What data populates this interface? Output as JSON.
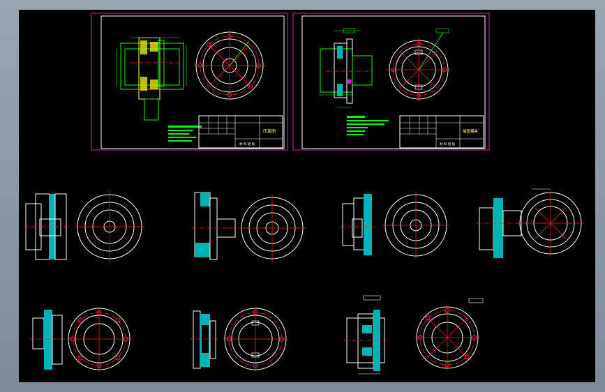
{
  "window": {
    "background_color": "#8d99a6",
    "canvas_color": "#000000"
  },
  "colors": {
    "sheet_border": "#c71585",
    "frame": "#ffffff",
    "green": "#00ff00",
    "yellow": "#ffff00",
    "red": "#ff2020",
    "cyan": "#00c8c8",
    "magenta": "#ff00ff"
  },
  "sheets": [
    {
      "id": "sheet-left",
      "titleblock_title": "压盖图",
      "titleblock_sub": "材 料 铝 板"
    },
    {
      "id": "sheet-right",
      "titleblock_title": "端盖模具",
      "titleblock_sub": "材 料 铝 板"
    }
  ],
  "icons": [
    "drawing-sheet-icon",
    "section-view-icon",
    "circular-view-icon"
  ]
}
